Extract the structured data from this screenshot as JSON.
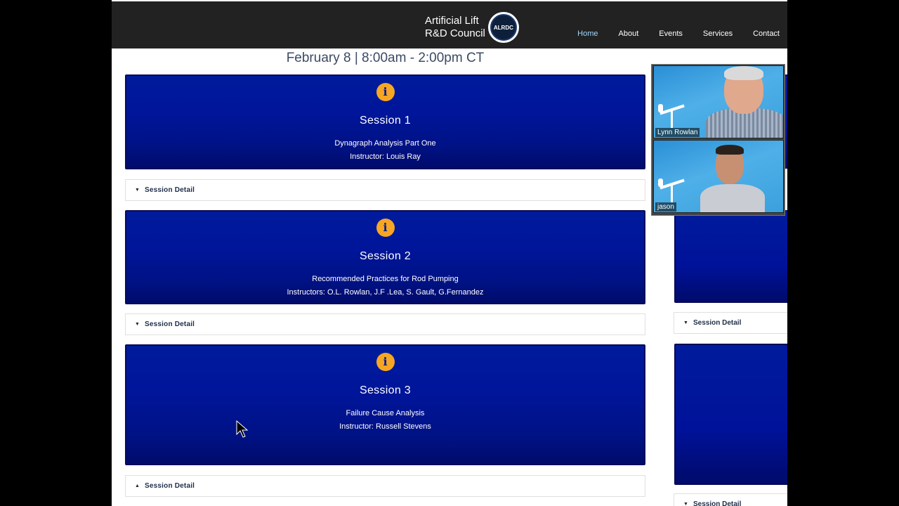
{
  "header": {
    "logo_line1": "Artificial Lift",
    "logo_line2": "R&D Council",
    "logo_badge": "ALRDC",
    "nav": [
      {
        "label": "Home",
        "active": true
      },
      {
        "label": "About",
        "active": false
      },
      {
        "label": "Events",
        "active": false
      },
      {
        "label": "Services",
        "active": false
      },
      {
        "label": "Contact",
        "active": false
      }
    ]
  },
  "main": {
    "date_line": "February 8 | 8:00am - 2:00pm CT",
    "sessions": [
      {
        "icon": "info-icon",
        "title": "Session 1",
        "desc_line1": "Dynagraph Analysis Part One",
        "desc_line2": "Instructor: Louis Ray",
        "detail_label": "Session Detail",
        "detail_caret": "▼"
      },
      {
        "icon": "info-icon",
        "title": "Session 2",
        "desc_line1": "Recommended Practices for Rod Pumping",
        "desc_line2": "Instructors: O.L. Rowlan, J.F .Lea, S. Gault, G.Fernandez",
        "detail_label": "Session Detail",
        "detail_caret": "▼"
      },
      {
        "icon": "info-icon",
        "title": "Session 3",
        "desc_line1": "Failure Cause Analysis",
        "desc_line2": "Instructor: Russell Stevens",
        "detail_label": "Session Detail",
        "detail_caret": "▲"
      }
    ],
    "info_glyph": "i"
  },
  "right_column": {
    "details": [
      {
        "label": "Session Detail",
        "caret": "▼"
      },
      {
        "label": "Session Detail",
        "caret": "▼"
      }
    ]
  },
  "video_call": {
    "participants": [
      {
        "name": "Lynn Rowlan"
      },
      {
        "name": "jason"
      }
    ]
  },
  "colors": {
    "card_blue": "#0016a0",
    "info_orange": "#f6a623",
    "header_bg": "#222222"
  }
}
